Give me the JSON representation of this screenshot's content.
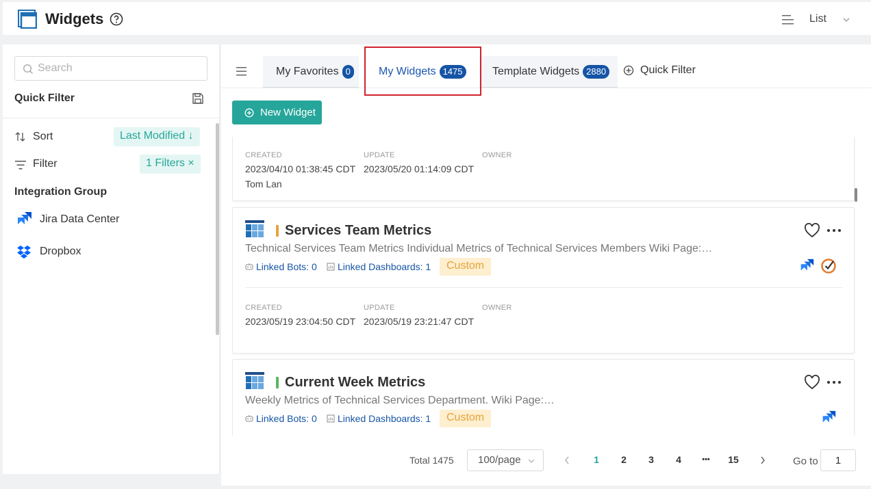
{
  "header": {
    "title": "Widgets",
    "view_mode": "List"
  },
  "sidebar": {
    "search_placeholder": "Search",
    "quick_filter_title": "Quick Filter",
    "sort_label": "Sort",
    "sort_value": "Last Modified ↓",
    "filter_label": "Filter",
    "filter_value": "1 Filters ×",
    "integration_group_title": "Integration Group",
    "integrations": [
      {
        "label": "Jira Data Center",
        "icon": "jira-icon"
      },
      {
        "label": "Dropbox",
        "icon": "dropbox-icon"
      }
    ]
  },
  "tabs": [
    {
      "label": "My Favorites",
      "count": "0"
    },
    {
      "label": "My Widgets",
      "count": "1475",
      "active": true
    },
    {
      "label": "Template Widgets",
      "count": "2880"
    }
  ],
  "quick_filter_link": "Quick Filter",
  "new_widget_label": "New Widget",
  "meta_labels": {
    "created": "CREATED",
    "update": "UPDATE",
    "owner": "OWNER"
  },
  "cards": [
    {
      "created": "2023/04/10 01:38:45 CDT",
      "updated": "2023/05/20 01:14:09 CDT",
      "owner": "Tom Lan"
    },
    {
      "title": "Services Team Metrics",
      "accent": "#e8a33a",
      "description": "Technical Services Team Metrics Individual Metrics of Technical Services Members Wiki Page:…",
      "linked_bots": "Linked Bots: 0",
      "linked_dashboards": "Linked Dashboards: 1",
      "tag": "Custom",
      "created": "2023/05/19 23:04:50 CDT",
      "updated": "2023/05/19 23:21:47 CDT",
      "owner": ""
    },
    {
      "title": "Current Week Metrics",
      "accent": "#5cb85c",
      "description": "Weekly Metrics of Technical Services Department. Wiki Page:…",
      "linked_bots": "Linked Bots: 0",
      "linked_dashboards": "Linked Dashboards: 1",
      "tag": "Custom"
    }
  ],
  "pagination": {
    "total": "Total 1475",
    "page_size": "100/page",
    "pages": [
      "1",
      "2",
      "3",
      "4",
      "•••",
      "15"
    ],
    "current": "1",
    "goto_label": "Go to",
    "goto_value": "1"
  },
  "colors": {
    "accent_teal": "#26a69a",
    "brand_blue": "#1554a6",
    "highlight_red": "#d0222a"
  }
}
